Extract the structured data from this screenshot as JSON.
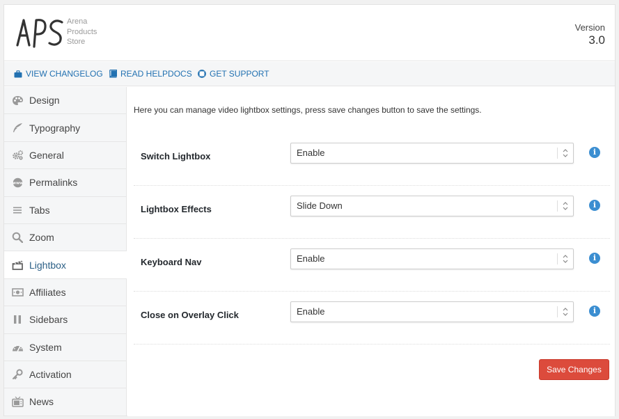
{
  "header": {
    "logo_text": [
      "Arena",
      "Products",
      "Store"
    ],
    "version_label": "Version",
    "version_number": "3.0"
  },
  "links": [
    {
      "label": "VIEW CHANGELOG",
      "icon": "briefcase-icon"
    },
    {
      "label": "READ HELPDOCS",
      "icon": "book-icon"
    },
    {
      "label": "GET SUPPORT",
      "icon": "lifebuoy-icon"
    }
  ],
  "sidebar": {
    "items": [
      {
        "label": "Design",
        "icon": "palette-icon"
      },
      {
        "label": "Typography",
        "icon": "feather-icon"
      },
      {
        "label": "General",
        "icon": "gears-icon"
      },
      {
        "label": "Permalinks",
        "icon": "www-icon"
      },
      {
        "label": "Tabs",
        "icon": "bars-icon"
      },
      {
        "label": "Zoom",
        "icon": "magnifier-icon"
      },
      {
        "label": "Lightbox",
        "icon": "clapperboard-icon",
        "active": true
      },
      {
        "label": "Affiliates",
        "icon": "money-icon"
      },
      {
        "label": "Sidebars",
        "icon": "columns-icon"
      },
      {
        "label": "System",
        "icon": "dashboard-icon"
      },
      {
        "label": "Activation",
        "icon": "key-icon"
      },
      {
        "label": "News",
        "icon": "tv-icon"
      }
    ]
  },
  "main": {
    "intro": "Here you can manage video lightbox settings, press save changes button to save the settings.",
    "settings": [
      {
        "label": "Switch Lightbox",
        "value": "Enable"
      },
      {
        "label": "Lightbox Effects",
        "value": "Slide Down"
      },
      {
        "label": "Keyboard Nav",
        "value": "Enable"
      },
      {
        "label": "Close on Overlay Click",
        "value": "Enable"
      }
    ],
    "info_glyph": "i",
    "save_label": "Save Changes"
  },
  "colors": {
    "accent_link": "#2271b1",
    "active_nav_text": "#2b5f86",
    "info_icon": "#3b8ed1",
    "save_button": "#dc4b3c"
  }
}
